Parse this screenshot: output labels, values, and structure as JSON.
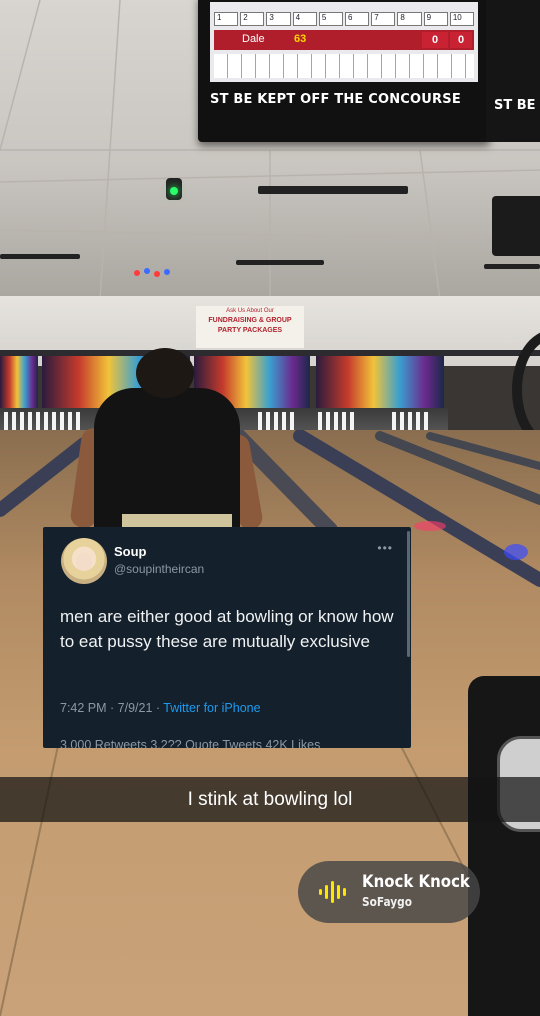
{
  "scoreboard": {
    "frames": [
      "1",
      "2",
      "3",
      "4",
      "5",
      "6",
      "7",
      "8",
      "9",
      "10"
    ],
    "player": "Dale",
    "score": "63",
    "frame_a": "0",
    "frame_b": "0",
    "ticker": "ST BE KEPT OFF THE CONCOURSE",
    "ticker_second": "ST BE"
  },
  "wall_sign": {
    "line1": "Ask Us About Our",
    "line2": "FUNDRAISING & GROUP",
    "line3": "PARTY PACKAGES"
  },
  "tweet": {
    "name": "Soup",
    "handle": "@soupintheircan",
    "more_icon": "more-icon",
    "text": "men are either good at bowling or know how to eat pussy these are mutually exclusive",
    "time": "7:42 PM · 7/9/21 · ",
    "source": "Twitter for iPhone",
    "stats": "3,000 Retweets 3,2?? Quote Tweets 42K Likes"
  },
  "caption": "I stink at bowling lol",
  "music": {
    "icon": "sound-wave-icon",
    "title": "Knock Knock",
    "artist": "SoFaygo"
  },
  "colors": {
    "tweet_bg": "#14202b",
    "link": "#1d9bf0",
    "score_red": "#c82233"
  }
}
